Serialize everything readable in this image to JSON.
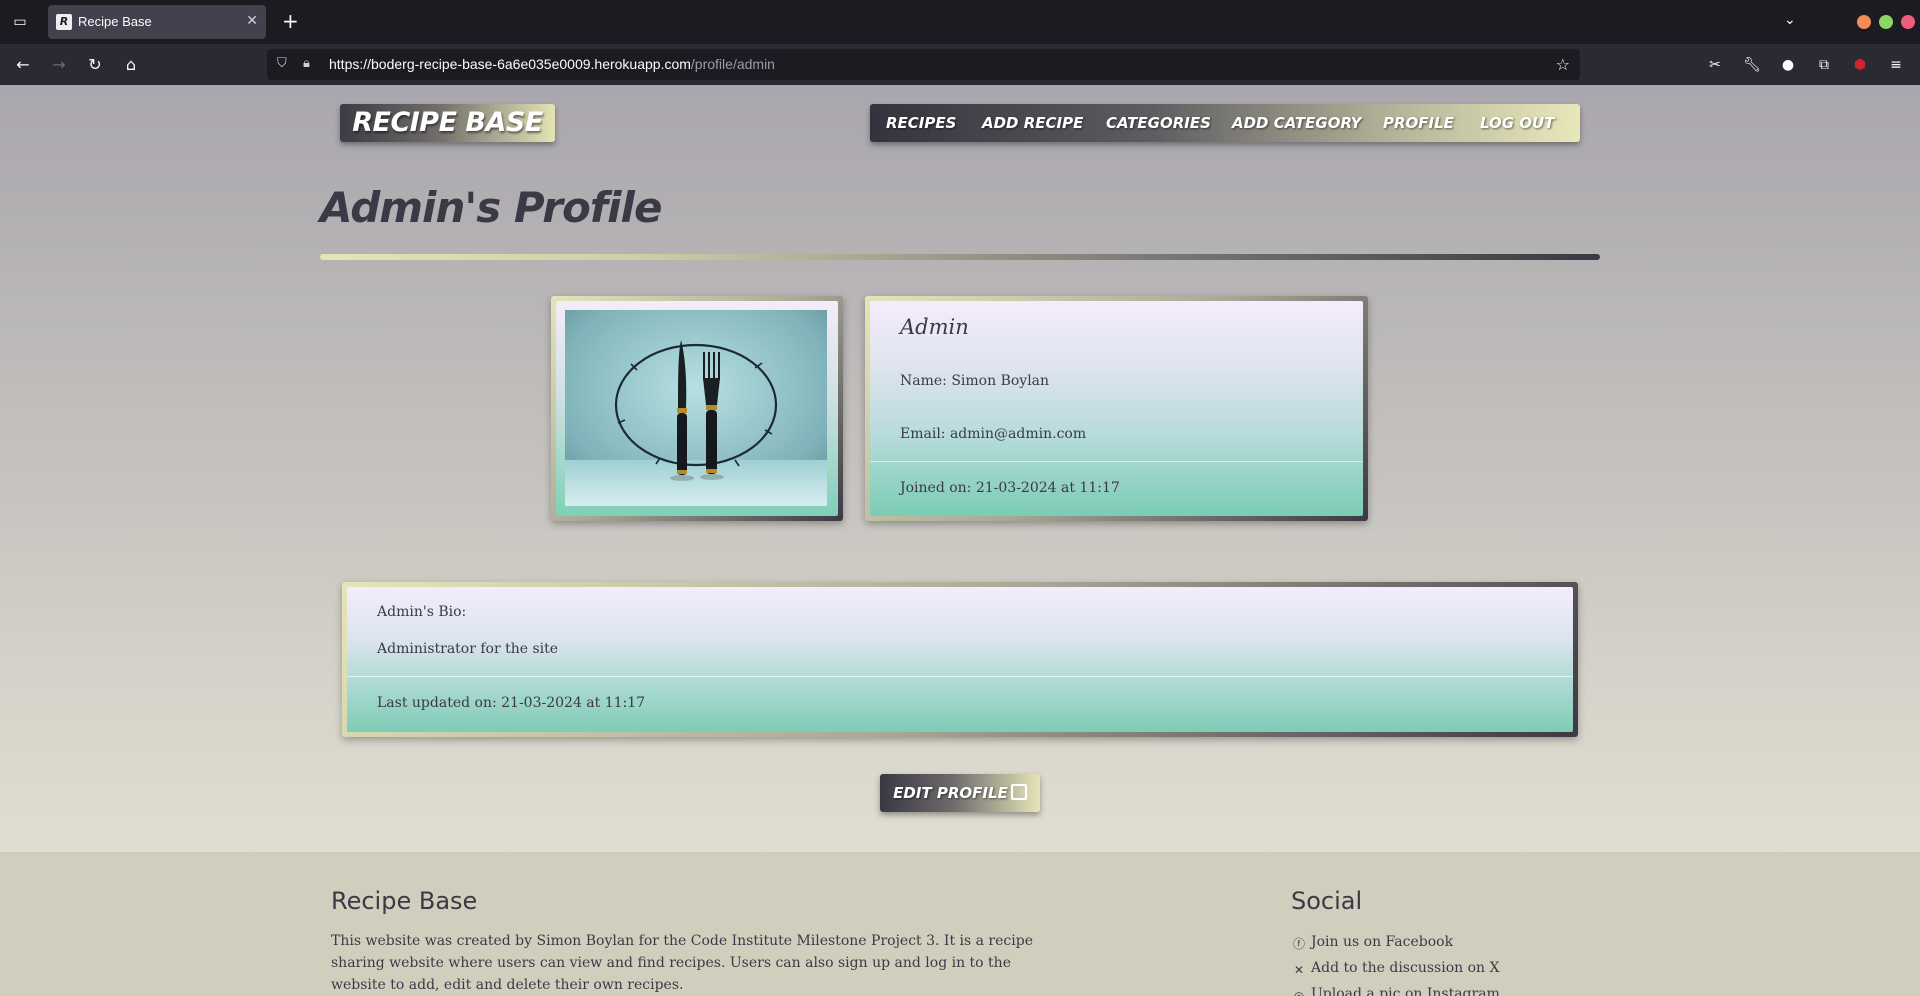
{
  "browser": {
    "tab_title": "Recipe Base",
    "tab_favicon_letter": "R",
    "url_base": "https://boderg-recipe-base-6a6e035e0009.herokuapp.com",
    "url_path": "/profile/admin",
    "window_controls": [
      "#f28c59",
      "#8bd665",
      "#f25b7d"
    ]
  },
  "site": {
    "brand": "RECIPE BASE",
    "nav": [
      "RECIPES",
      "ADD RECIPE",
      "CATEGORIES",
      "ADD CATEGORY",
      "PROFILE",
      "LOG OUT"
    ]
  },
  "profile": {
    "page_title": "Admin's Profile",
    "username": "Admin",
    "name_line": "Name: Simon Boylan",
    "email_line": "Email: admin@admin.com",
    "joined_line": "Joined on: 21-03-2024 at 11:17",
    "bio_heading": "Admin's Bio:",
    "bio_text": "Administrator for the site",
    "updated_line": "Last updated on: 21-03-2024 at 11:17",
    "edit_label": "EDIT PROFILE"
  },
  "footer": {
    "about_heading": "Recipe Base",
    "about_text": "This website was created by Simon Boylan for the Code Institute Milestone Project 3. It is a recipe sharing website where users can view and find recipes. Users can also sign up and log in to the website to add, edit and delete their own recipes.",
    "social_heading": "Social",
    "social_links": [
      {
        "label": "Join us on Facebook",
        "icon": "facebook-icon"
      },
      {
        "label": "Add to the discussion on X",
        "icon": "x-icon"
      },
      {
        "label": "Upload a pic on Instagram",
        "icon": "instagram-icon"
      }
    ]
  }
}
